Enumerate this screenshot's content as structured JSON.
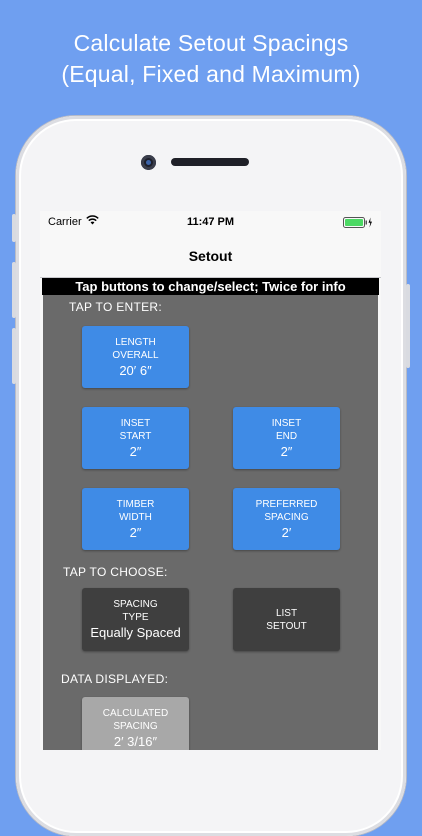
{
  "headline": {
    "line1": "Calculate Setout Spacings",
    "line2": "(Equal, Fixed and Maximum)"
  },
  "status_bar": {
    "carrier": "Carrier",
    "time": "11:47 PM",
    "icons": [
      "wifi-icon",
      "battery-icon"
    ]
  },
  "nav": {
    "title": "Setout"
  },
  "banner": "Tap buttons to change/select; Twice for info",
  "sections": {
    "enter": "TAP TO ENTER:",
    "choose": "TAP TO CHOOSE:",
    "data": "DATA DISPLAYED:"
  },
  "tiles": {
    "length_overall": {
      "line1": "LENGTH",
      "line2": "OVERALL",
      "value": "20′ 6″"
    },
    "inset_start": {
      "line1": "INSET",
      "line2": "START",
      "value": "2″"
    },
    "inset_end": {
      "line1": "INSET",
      "line2": "END",
      "value": "2″"
    },
    "timber_width": {
      "line1": "TIMBER",
      "line2": "WIDTH",
      "value": "2″"
    },
    "preferred_spacing": {
      "line1": "PREFERRED",
      "line2": "SPACING",
      "value": "2′"
    },
    "spacing_type": {
      "line1": "SPACING",
      "line2": "TYPE",
      "value": "Equally Spaced"
    },
    "list_setout": {
      "line1": "LIST",
      "line2": "SETOUT"
    },
    "calculated_spacing": {
      "line1": "CALCULATED",
      "line2": "SPACING",
      "value": "2′ 3/16″"
    }
  },
  "colors": {
    "background": "#6f9ff0",
    "blue_button": "#3f8be6",
    "dark_button": "#3f3f3f",
    "gray_button": "#a8a8a8",
    "panel": "#6a6a6a",
    "battery": "#4cd964"
  }
}
